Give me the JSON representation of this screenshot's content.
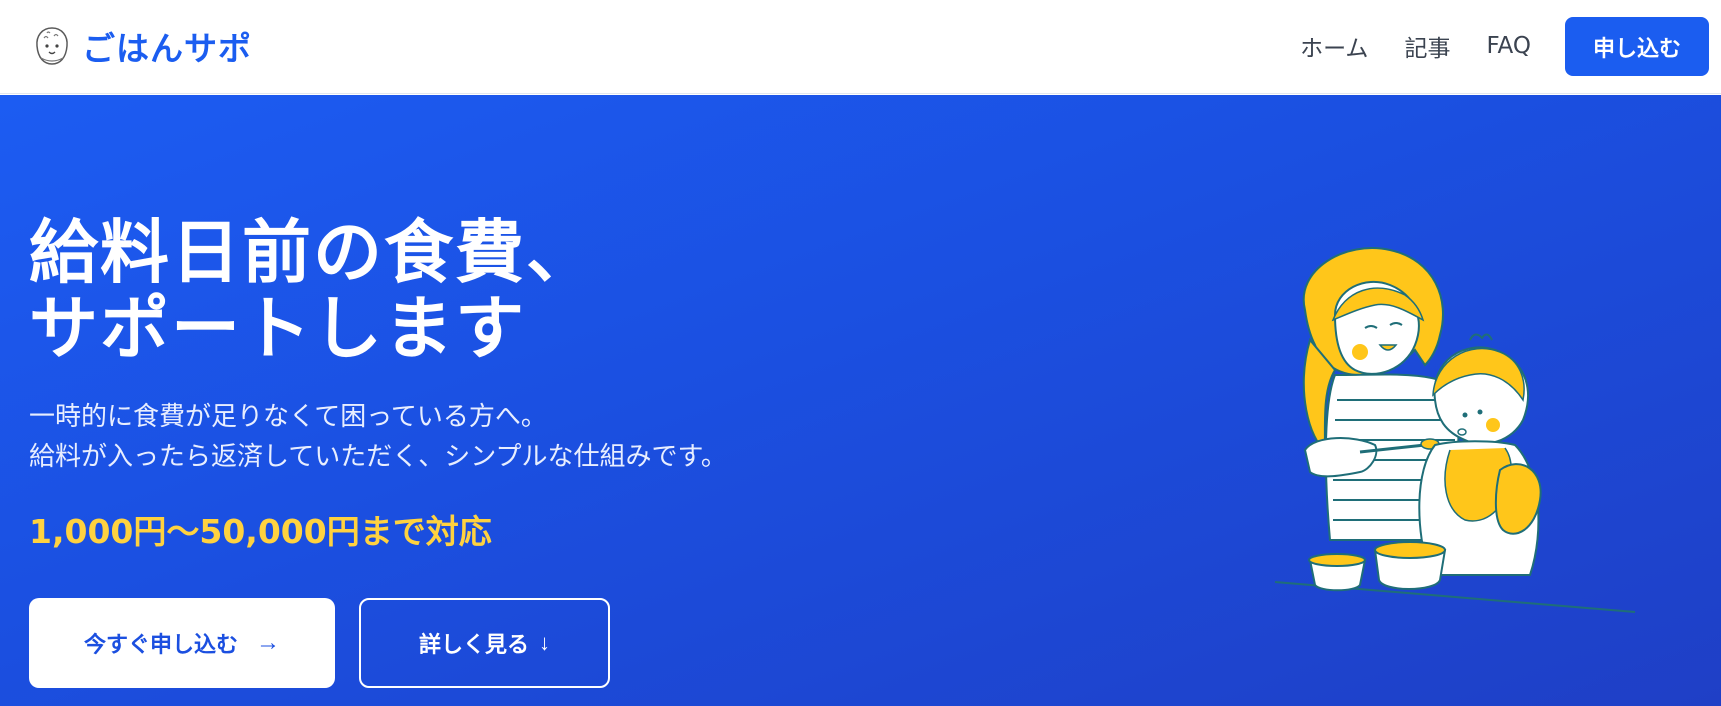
{
  "header": {
    "logo_text": "ごはんサポ",
    "nav": [
      {
        "label": "ホーム"
      },
      {
        "label": "記事"
      },
      {
        "label": "FAQ"
      }
    ],
    "apply_label": "申し込む"
  },
  "hero": {
    "title_line1": "給料日前の食費、",
    "title_line2": "サポートします",
    "desc_line1": "一時的に食費が足りなくて困っている方へ。",
    "desc_line2": "給料が入ったら返済していただく、シンプルな仕組みです。",
    "range": "1,000円〜50,000円まで対応",
    "primary_button": "今すぐ申し込む",
    "primary_arrow": "→",
    "secondary_button": "詳しく見る",
    "secondary_arrow": "↓"
  },
  "colors": {
    "brand": "#1b5df0",
    "hero_bg": "#1b4fe0",
    "accent_yellow": "#ffd23f",
    "illustration_line": "#1f6e78"
  },
  "icons": {
    "logo": "rice-ball-icon",
    "illustration": "mother-feeding-baby-illustration"
  }
}
